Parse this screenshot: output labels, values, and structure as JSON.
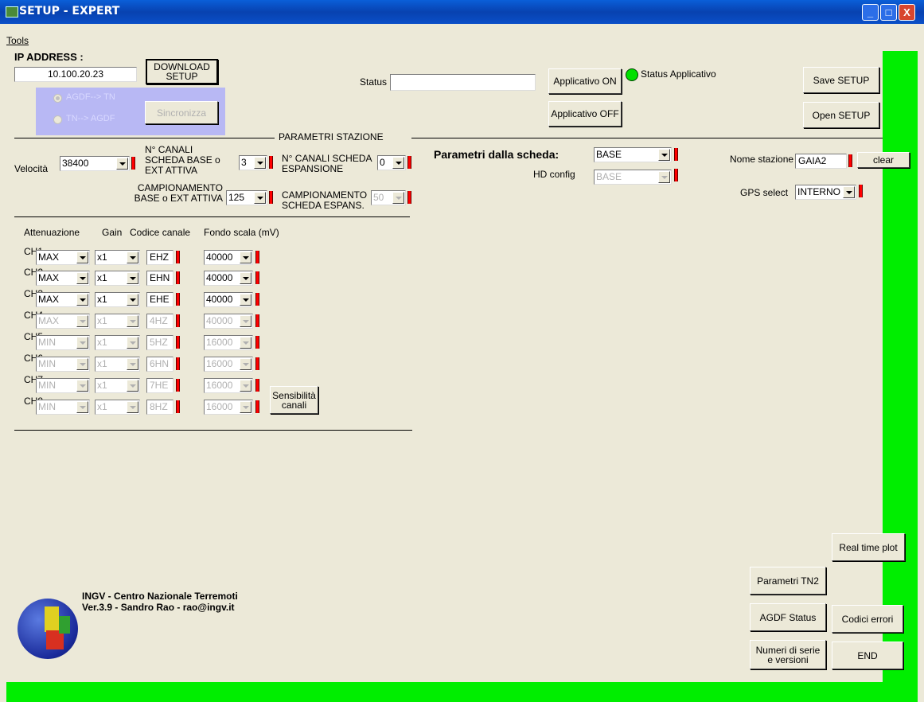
{
  "window": {
    "title": "SETUP - EXPERT",
    "min": "_",
    "max": "□",
    "close": "X"
  },
  "menu": {
    "tools": "Tools"
  },
  "ip": {
    "label": "IP ADDRESS :",
    "value": "10.100.20.23",
    "download_btn": "DOWNLOAD SETUP"
  },
  "sync": {
    "opt1": "AGDF--> TN",
    "opt2": "TN--> AGDF",
    "button": "Sincronizza"
  },
  "status": {
    "label": "Status",
    "value": "",
    "app_on": "Applicativo ON",
    "app_off": "Applicativo OFF",
    "app_status_label": "Status Applicativo",
    "led_color": "#00e000"
  },
  "setup_buttons": {
    "save": "Save SETUP",
    "open": "Open SETUP"
  },
  "station": {
    "section_title": "PARAMETRI STAZIONE",
    "velocita_label": "Velocità",
    "velocita_value": "38400",
    "canali_base_label": "N° CANALI SCHEDA BASE o EXT ATTIVA",
    "canali_base_value": "3",
    "canali_esp_label": "N° CANALI SCHEDA ESPANSIONE",
    "canali_esp_value": "0",
    "camp_base_label": "CAMPIONAMENTO BASE o EXT ATTIVA",
    "camp_base_value": "125",
    "camp_esp_label": "CAMPIONAMENTO SCHEDA ESPANS.",
    "camp_esp_value": "50"
  },
  "board": {
    "label": "Parametri dalla scheda:",
    "value": "BASE",
    "hd_label": "HD config",
    "hd_value": "BASE"
  },
  "nome": {
    "label": "Nome stazione",
    "value": "GAIA2",
    "clear": "clear"
  },
  "gps": {
    "label": "GPS select",
    "value": "INTERNO"
  },
  "channels_header": {
    "att": "Attenuazione",
    "gain": "Gain",
    "codice": "Codice canale",
    "fondo": "Fondo scala (mV)"
  },
  "channels": [
    {
      "name": "CH1",
      "att": "MAX",
      "gain": "x1",
      "code": "EHZ",
      "fs": "40000"
    },
    {
      "name": "CH2",
      "att": "MAX",
      "gain": "x1",
      "code": "EHN",
      "fs": "40000"
    },
    {
      "name": "CH3",
      "att": "MAX",
      "gain": "x1",
      "code": "EHE",
      "fs": "40000"
    },
    {
      "name": "CH4",
      "att": "MAX",
      "gain": "x1",
      "code": "4HZ",
      "fs": "40000"
    },
    {
      "name": "CH5",
      "att": "MIN",
      "gain": "x1",
      "code": "5HZ",
      "fs": "16000"
    },
    {
      "name": "CH6",
      "att": "MIN",
      "gain": "x1",
      "code": "6HN",
      "fs": "16000"
    },
    {
      "name": "CH7",
      "att": "MIN",
      "gain": "x1",
      "code": "7HE",
      "fs": "16000"
    },
    {
      "name": "CH8",
      "att": "MIN",
      "gain": "x1",
      "code": "8HZ",
      "fs": "16000"
    }
  ],
  "sensibilita": "Sensibilità canali",
  "footer": {
    "line1": "INGV - Centro Nazionale Terremoti",
    "line2": "Ver.3.9 - Sandro Rao - rao@ingv.it"
  },
  "side_buttons": {
    "real_time": "Real time plot",
    "parametri_tn2": "Parametri TN2",
    "agdf_status": "AGDF Status",
    "codici_errori": "Codici errori",
    "numeri_serie": "Numeri di serie e versioni",
    "end": "END"
  },
  "colors": {
    "accent_green": "#00ee00",
    "panel": "#ece9d8",
    "sync_panel": "#b8b8f4",
    "marker": "#ff0000"
  }
}
